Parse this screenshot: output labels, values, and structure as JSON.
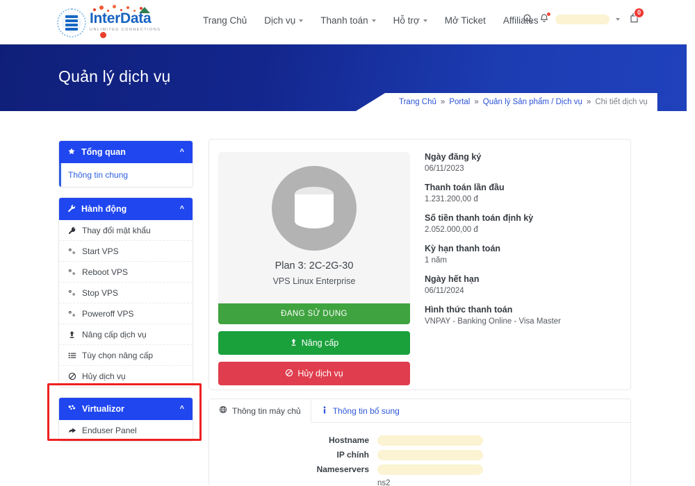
{
  "header": {
    "logo": {
      "name_part1": "Inter",
      "name_part2": "Data",
      "tagline": "UNLIMITED CONNECTIONS"
    },
    "nav": [
      {
        "label": "Trang Chủ",
        "has_dropdown": false
      },
      {
        "label": "Dịch vụ",
        "has_dropdown": true
      },
      {
        "label": "Thanh toán",
        "has_dropdown": true
      },
      {
        "label": "Hỗ trợ",
        "has_dropdown": true
      },
      {
        "label": "Mở Ticket",
        "has_dropdown": false
      },
      {
        "label": "Affiliates",
        "has_dropdown": false
      }
    ],
    "search_icon": "search-icon",
    "bell_icon": "bell-icon",
    "account_name": "",
    "cart_icon": "cart-icon",
    "cart_count": "0"
  },
  "hero": {
    "title": "Quản lý dịch vụ",
    "breadcrumb": [
      {
        "label": "Trang Chủ",
        "link": true
      },
      {
        "label": "Portal",
        "link": true
      },
      {
        "label": "Quản lý Sản phẩm / Dịch vụ",
        "link": true
      },
      {
        "label": "Chi tiết dịch vụ",
        "link": false
      }
    ],
    "separator": "»"
  },
  "sidebar": {
    "sections": [
      {
        "title": "Tổng quan",
        "icon": "star-icon",
        "collapse_icon": "chevron-up-icon",
        "items": [
          {
            "label": "Thông tin chung",
            "icon": "",
            "active": true
          }
        ]
      },
      {
        "title": "Hành động",
        "icon": "wrench-icon",
        "collapse_icon": "chevron-up-icon",
        "items": [
          {
            "label": "Thay đổi mật khẩu",
            "icon": "key-icon",
            "active": false
          },
          {
            "label": "Start VPS",
            "icon": "cogs-icon",
            "active": false
          },
          {
            "label": "Reboot VPS",
            "icon": "cogs-icon",
            "active": false
          },
          {
            "label": "Stop VPS",
            "icon": "cogs-icon",
            "active": false
          },
          {
            "label": "Poweroff VPS",
            "icon": "cogs-icon",
            "active": false
          },
          {
            "label": "Nâng cấp dịch vụ",
            "icon": "arrow-up-icon",
            "active": false
          },
          {
            "label": "Tùy chọn nâng cấp",
            "icon": "list-icon",
            "active": false
          },
          {
            "label": "Hủy dịch vụ",
            "icon": "ban-icon",
            "active": false
          }
        ]
      },
      {
        "title": "Virtualizor",
        "icon": "cubes-icon",
        "collapse_icon": "chevron-up-icon",
        "highlighted": true,
        "items": [
          {
            "label": "Enduser Panel",
            "icon": "share-icon",
            "active": false
          }
        ]
      }
    ]
  },
  "product": {
    "image_icon": "database-icon",
    "plan_name": "Plan 3: 2C-2G-30",
    "product_line": "VPS Linux Enterprise",
    "status_label": "ĐANG SỬ DỤNG",
    "upgrade_button": "Nâng cấp",
    "upgrade_icon": "arrow-up-icon",
    "cancel_button": "Hủy dịch vụ",
    "cancel_icon": "ban-icon"
  },
  "details": [
    {
      "label": "Ngày đăng ký",
      "value": "06/11/2023"
    },
    {
      "label": "Thanh toán lần đầu",
      "value": "1.231.200,00 đ"
    },
    {
      "label": "Số tiền thanh toán định kỳ",
      "value": "2.052.000,00 đ"
    },
    {
      "label": "Kỳ hạn thanh toán",
      "value": "1 năm"
    },
    {
      "label": "Ngày hết hạn",
      "value": "06/11/2024"
    },
    {
      "label": "Hình thức thanh toán",
      "value": "VNPAY - Banking Online - Visa Master"
    }
  ],
  "tabs": [
    {
      "label": "Thông tin máy chủ",
      "icon": "globe-icon",
      "active": true
    },
    {
      "label": "Thông tin bổ sung",
      "icon": "info-icon",
      "active": false
    }
  ],
  "server_info": {
    "rows": [
      {
        "label": "Hostname",
        "value": "",
        "redacted": true
      },
      {
        "label": "IP chính",
        "value": "",
        "redacted": true
      },
      {
        "label": "Nameservers",
        "value": "",
        "redacted": true
      }
    ],
    "nameserver_extra": "ns2"
  },
  "colors": {
    "brand_blue": "#1f46ef",
    "hero_navy": "#0f1f79",
    "hero_blue": "#1f41bb",
    "link_blue": "#2c54d4",
    "green": "#1aa13c",
    "status_green": "#3fa33f",
    "red": "#e03d4e",
    "badge_red": "#ee3a33",
    "annotation_red": "#ee2020",
    "redaction_yellow": "#fbf3d2"
  }
}
